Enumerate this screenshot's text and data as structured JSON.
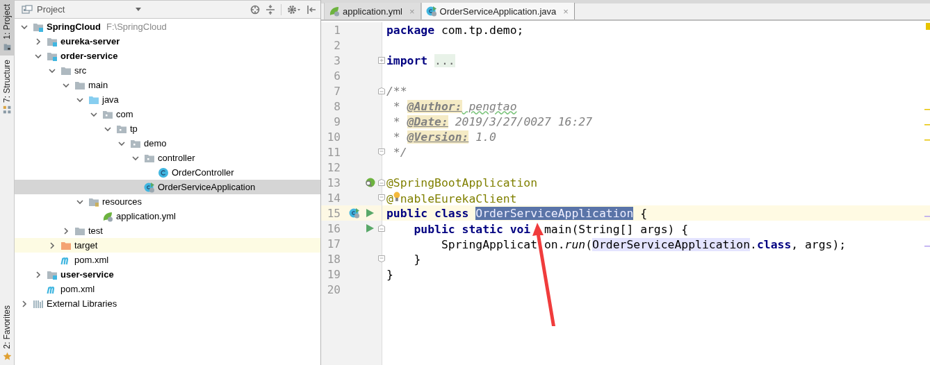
{
  "tool_stripe": [
    {
      "label": "1: Project",
      "kind": "project",
      "selected": true
    },
    {
      "label": "7: Structure",
      "kind": "structure",
      "selected": false
    },
    {
      "label": "2: Favorites",
      "kind": "favorites",
      "selected": false
    }
  ],
  "project_panel": {
    "title": "Project",
    "tree": [
      {
        "label": "SpringCloud",
        "path": "F:\\SpringCloud",
        "kind": "module",
        "expanded": true,
        "selected": false,
        "children": [
          {
            "label": "eureka-server",
            "kind": "module",
            "expanded": false,
            "selected": false
          },
          {
            "label": "order-service",
            "kind": "module",
            "expanded": true,
            "selected": false,
            "children": [
              {
                "label": "src",
                "kind": "folder",
                "expanded": true,
                "selected": false,
                "children": [
                  {
                    "label": "main",
                    "kind": "folder",
                    "expanded": true,
                    "selected": false,
                    "children": [
                      {
                        "label": "java",
                        "kind": "source-folder",
                        "expanded": true,
                        "selected": false,
                        "children": [
                          {
                            "label": "com",
                            "kind": "package",
                            "expanded": true,
                            "selected": false,
                            "children": [
                              {
                                "label": "tp",
                                "kind": "package",
                                "expanded": true,
                                "selected": false,
                                "children": [
                                  {
                                    "label": "demo",
                                    "kind": "package",
                                    "expanded": true,
                                    "selected": false,
                                    "children": [
                                      {
                                        "label": "controller",
                                        "kind": "package",
                                        "expanded": true,
                                        "selected": false,
                                        "children": [
                                          {
                                            "label": "OrderController",
                                            "kind": "class",
                                            "selected": false
                                          }
                                        ]
                                      },
                                      {
                                        "label": "OrderServiceApplication",
                                        "kind": "spring-class",
                                        "selected": true
                                      }
                                    ]
                                  }
                                ]
                              }
                            ]
                          }
                        ]
                      },
                      {
                        "label": "resources",
                        "kind": "resources",
                        "expanded": true,
                        "selected": false,
                        "children": [
                          {
                            "label": "application.yml",
                            "kind": "yml",
                            "selected": false
                          }
                        ]
                      }
                    ]
                  },
                  {
                    "label": "test",
                    "kind": "folder",
                    "expanded": false,
                    "selected": false
                  }
                ]
              },
              {
                "label": "target",
                "kind": "excluded-folder",
                "expanded": false,
                "selected": false
              },
              {
                "label": "pom.xml",
                "kind": "maven",
                "selected": false
              }
            ]
          },
          {
            "label": "user-service",
            "kind": "module",
            "expanded": false,
            "selected": false
          },
          {
            "label": "pom.xml",
            "kind": "maven",
            "selected": false
          }
        ]
      },
      {
        "label": "External Libraries",
        "kind": "libraries",
        "expanded": false,
        "selected": false
      }
    ]
  },
  "editor": {
    "tabs": [
      {
        "label": "application.yml",
        "kind": "yml",
        "close": "×",
        "selected": false
      },
      {
        "label": "OrderServiceApplication.java",
        "kind": "spring-class",
        "close": "×",
        "selected": true
      }
    ],
    "lines": [
      {
        "number": "1",
        "current": false,
        "tokens": [
          {
            "kind": "keyword",
            "text": "package"
          },
          {
            "kind": "plain",
            "text": " com.tp.demo;"
          }
        ]
      },
      {
        "number": "2",
        "current": false
      },
      {
        "number": "3",
        "current": false,
        "fold": {
          "kind": "expand"
        },
        "tokens": [
          {
            "kind": "keyword",
            "text": "import "
          },
          {
            "kind": "folded",
            "text": "..."
          }
        ]
      },
      {
        "number": "6",
        "current": false
      },
      {
        "number": "7",
        "current": false,
        "fold": {
          "kind": "start"
        },
        "tokens": [
          {
            "kind": "comment",
            "text": "/**"
          }
        ]
      },
      {
        "number": "8",
        "current": false,
        "tokens": [
          {
            "kind": "comment",
            "text": " * "
          },
          {
            "kind": "doctag",
            "text": "@Author:"
          },
          {
            "kind": "typo",
            "text": " pengtao"
          }
        ]
      },
      {
        "number": "9",
        "current": false,
        "tokens": [
          {
            "kind": "comment",
            "text": " * "
          },
          {
            "kind": "doctag",
            "text": "@Date:"
          },
          {
            "kind": "comment",
            "text": " 2019/3/27/0027 16:27"
          }
        ]
      },
      {
        "number": "10",
        "current": false,
        "tokens": [
          {
            "kind": "comment",
            "text": " * "
          },
          {
            "kind": "doctag",
            "text": "@Version:"
          },
          {
            "kind": "comment",
            "text": " 1.0"
          }
        ]
      },
      {
        "number": "11",
        "current": false,
        "fold": {
          "kind": "end"
        },
        "tokens": [
          {
            "kind": "comment",
            "text": " */"
          }
        ]
      },
      {
        "number": "12",
        "current": false
      },
      {
        "number": "13",
        "current": false,
        "fold": {
          "kind": "start"
        },
        "gutter": [
          {
            "kind": "bean"
          }
        ],
        "tokens": [
          {
            "kind": "annotation",
            "text": "@SpringBootApplication"
          }
        ]
      },
      {
        "number": "14",
        "current": false,
        "fold": {
          "kind": "end"
        },
        "tokens": [
          {
            "kind": "annotation",
            "text": "@"
          },
          {
            "kind": "bulb"
          },
          {
            "kind": "annotation",
            "text": "nableEurekaClient"
          }
        ]
      },
      {
        "number": "15",
        "current": true,
        "gutter": [
          {
            "kind": "spring-class"
          },
          {
            "kind": "run"
          }
        ],
        "tokens": [
          {
            "kind": "keyword",
            "text": "public"
          },
          {
            "kind": "keyword",
            "text": " class "
          },
          {
            "kind": "selection",
            "text": "OrderServiceApplication"
          },
          {
            "kind": "plain",
            "text": " {"
          }
        ]
      },
      {
        "number": "16",
        "current": false,
        "fold": {
          "kind": "start"
        },
        "gutter": [
          {
            "kind": "run"
          }
        ],
        "tokens": [
          {
            "kind": "keyword",
            "text": "    public"
          },
          {
            "kind": "keyword",
            "text": " static"
          },
          {
            "kind": "keyword",
            "text": " voi"
          },
          {
            "kind": "covered"
          },
          {
            "kind": "plain",
            "text": " main(String[] args) {"
          }
        ]
      },
      {
        "number": "17",
        "current": false,
        "tokens": [
          {
            "kind": "plain",
            "text": "        SpringApplicat"
          },
          {
            "kind": "covered"
          },
          {
            "kind": "plain",
            "text": "on."
          },
          {
            "kind": "method",
            "text": "run"
          },
          {
            "kind": "plain",
            "text": "("
          },
          {
            "kind": "usage",
            "text": "OrderServiceApplication"
          },
          {
            "kind": "plain",
            "text": "."
          },
          {
            "kind": "keyword",
            "text": "class"
          },
          {
            "kind": "plain",
            "text": ", args);"
          }
        ]
      },
      {
        "number": "18",
        "current": false,
        "fold": {
          "kind": "end"
        },
        "tokens": [
          {
            "kind": "plain",
            "text": "    }"
          }
        ]
      },
      {
        "number": "19",
        "current": false,
        "tokens": [
          {
            "kind": "plain",
            "text": "}"
          }
        ]
      },
      {
        "number": "20",
        "current": false
      }
    ]
  }
}
